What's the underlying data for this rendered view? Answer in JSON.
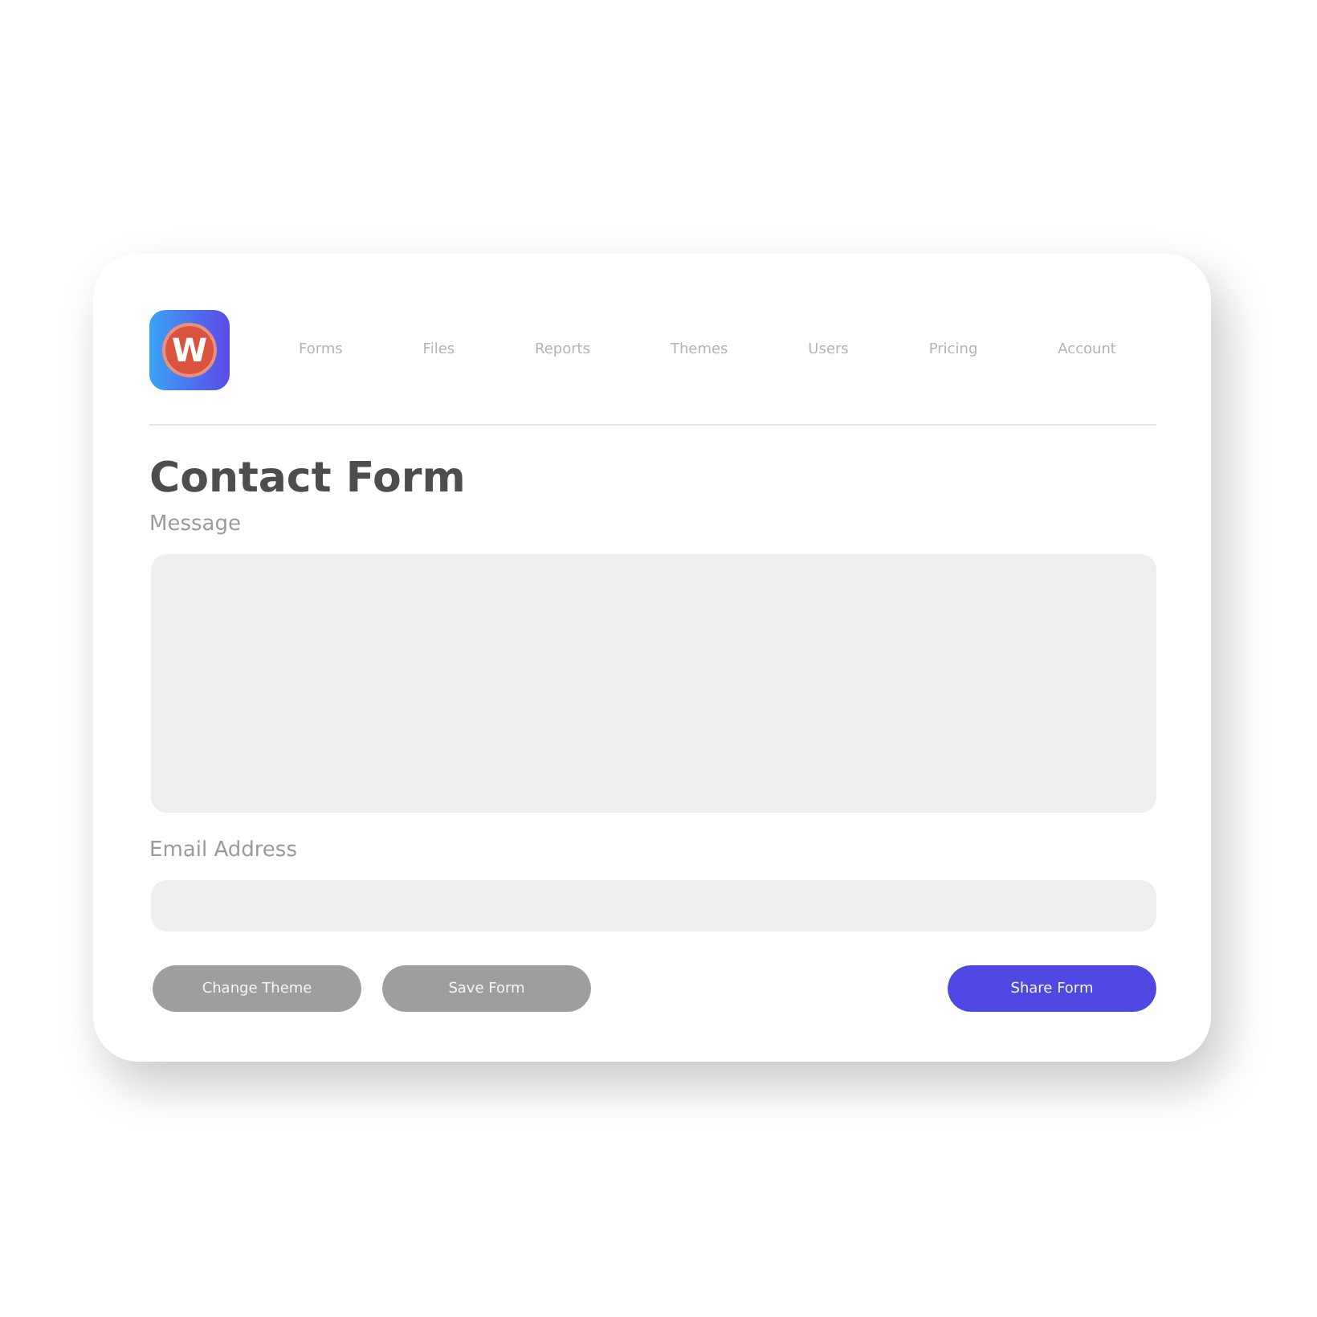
{
  "logo": {
    "letter": "W"
  },
  "nav": [
    {
      "label": "Forms"
    },
    {
      "label": "Files"
    },
    {
      "label": "Reports"
    },
    {
      "label": "Themes"
    },
    {
      "label": "Users"
    },
    {
      "label": "Pricing"
    },
    {
      "label": "Account"
    }
  ],
  "title": "Contact Form",
  "fields": [
    {
      "label": "Message",
      "kind": "textarea"
    },
    {
      "label": "Email Address",
      "kind": "input"
    }
  ],
  "buttons": [
    {
      "label": "Change Theme",
      "kind": "secondary"
    },
    {
      "label": "Save Form",
      "kind": "secondary"
    },
    {
      "label": "Share Form",
      "kind": "primary"
    }
  ]
}
